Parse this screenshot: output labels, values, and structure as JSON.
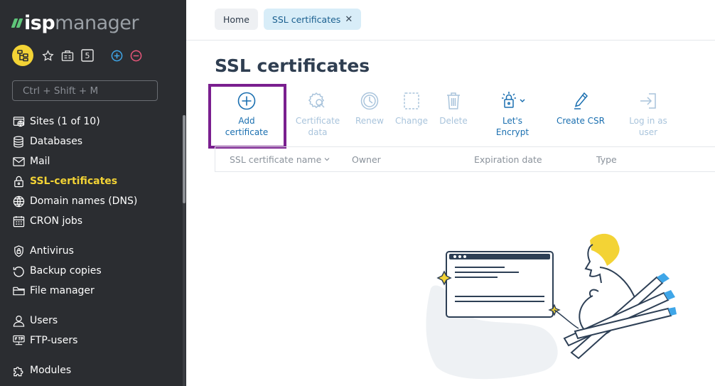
{
  "brand": {
    "name_bold": "isp",
    "name_light": "manager",
    "accent": "#5fc67a"
  },
  "quick": {
    "badge_number": "5"
  },
  "search": {
    "placeholder": "Ctrl + Shift + M"
  },
  "nav": [
    {
      "label": "Sites (1 of 10)",
      "icon": "globe-icon"
    },
    {
      "label": "Databases",
      "icon": "database-icon"
    },
    {
      "label": "Mail",
      "icon": "mail-icon"
    },
    {
      "label": "SSL-certificates",
      "icon": "lock-icon",
      "active": true
    },
    {
      "label": "Domain names (DNS)",
      "icon": "dns-icon"
    },
    {
      "label": "CRON jobs",
      "icon": "calendar-icon"
    },
    {
      "label": "Antivirus",
      "icon": "shield-icon"
    },
    {
      "label": "Backup copies",
      "icon": "backup-icon"
    },
    {
      "label": "File manager",
      "icon": "folder-icon"
    },
    {
      "label": "Users",
      "icon": "user-icon"
    },
    {
      "label": "FTP-users",
      "icon": "ftp-icon"
    },
    {
      "label": "Modules",
      "icon": "modules-icon"
    }
  ],
  "tabs": [
    {
      "label": "Home",
      "active": false
    },
    {
      "label": "SSL certificates",
      "active": true
    }
  ],
  "page": {
    "title": "SSL certificates"
  },
  "toolbar": {
    "add_line1": "Add",
    "add_line2": "certificate",
    "data_line1": "Certificate",
    "data_line2": "data",
    "renew": "Renew",
    "change": "Change",
    "delete": "Delete",
    "le_line1": "Let's",
    "le_line2": "Encrypt",
    "csr": "Create CSR",
    "login_line1": "Log in as",
    "login_line2": "user"
  },
  "table": {
    "columns": [
      "SSL certificate name",
      "Owner",
      "Expiration date",
      "Type"
    ]
  },
  "colors": {
    "active_nav": "#f3d335",
    "link_blue": "#1a6fb0",
    "highlight": "#7a1f8f"
  }
}
